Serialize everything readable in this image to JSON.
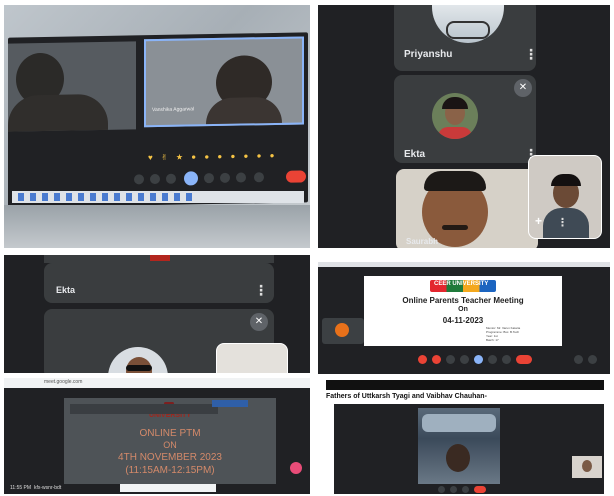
{
  "panel1": {
    "participant_label": "Vanshika Aggarwal"
  },
  "panel2": {
    "participants": [
      {
        "name": "Priyanshu"
      },
      {
        "name": "Ekta"
      }
    ],
    "self_view_label": "Saurabh"
  },
  "panel3": {
    "participant": "Ekta"
  },
  "panel4": {
    "slide_title": "Online Parents Teacher Meeting",
    "slide_on": "On",
    "slide_date": "04-11-2023",
    "slide_details": [
      "Mentor: Mr. Varun Kataria",
      "Programme: Bsc. B.Tech",
      "Year: 1st",
      "Batch: 17"
    ],
    "logo_text": "CEER UNIVERSITY"
  },
  "panel5": {
    "url": "meet.google.com",
    "logo_text": "UNIVERSITY",
    "slide_lines": [
      "ONLINE PTM",
      "ON",
      "4TH NOVEMBER 2023",
      "(11:15AM-12:15PM)"
    ],
    "time_label": "11:55 PM",
    "meeting_code": "kfx-wsnr-bdt"
  },
  "panel6": {
    "caption": "Fathers of Uttkarsh Tyagi and Vaibhav Chauhan-"
  },
  "colors": {
    "meet_dark": "#202124",
    "tile": "#3c4043",
    "end_call": "#ea4335"
  }
}
